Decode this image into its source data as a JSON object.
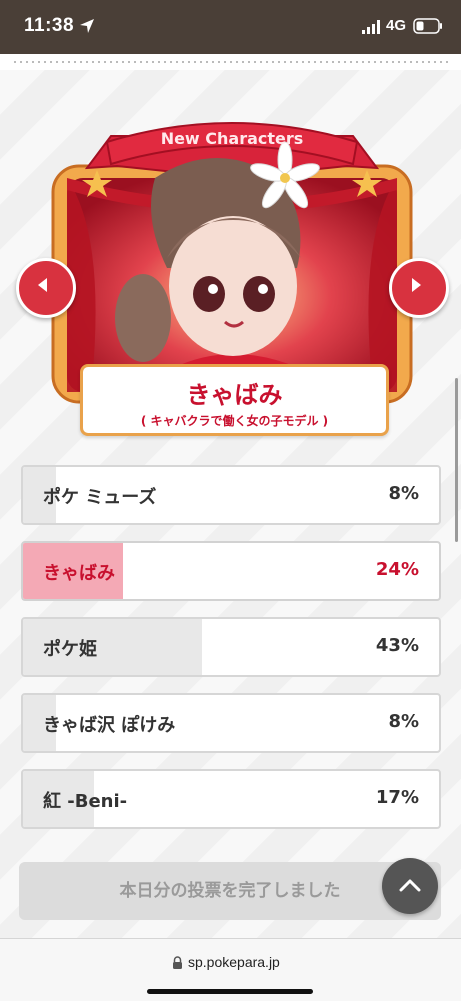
{
  "status_bar": {
    "time": "11:38",
    "network": "4G"
  },
  "banner": {
    "ribbon_text": "New Characters",
    "character_name": "きゃばみ",
    "character_description": "( キャバクラで働く女の子モデル )"
  },
  "poll": {
    "options": [
      {
        "label": "ポケ ミューズ",
        "percent_text": "8%",
        "percent": 8,
        "selected": false
      },
      {
        "label": "きゃばみ",
        "percent_text": "24%",
        "percent": 24,
        "selected": true
      },
      {
        "label": "ポケ姫",
        "percent_text": "43%",
        "percent": 43,
        "selected": false
      },
      {
        "label": "きゃば沢 ぽけみ",
        "percent_text": "8%",
        "percent": 8,
        "selected": false
      },
      {
        "label": "紅 -Beni-",
        "percent_text": "17%",
        "percent": 17,
        "selected": false
      }
    ],
    "completed_label": "本日分の投票を完了しました"
  },
  "browser": {
    "url": "sp.pokepara.jp"
  },
  "colors": {
    "accent": "#c8102e",
    "nav_button": "#d8323f",
    "status_bar": "#4a3f37",
    "selected_fill": "#f4a9b5"
  },
  "icons": [
    "location-arrow-icon",
    "signal-icon",
    "battery-icon",
    "chevron-left-icon",
    "chevron-right-icon",
    "chevron-up-icon",
    "lock-icon"
  ]
}
